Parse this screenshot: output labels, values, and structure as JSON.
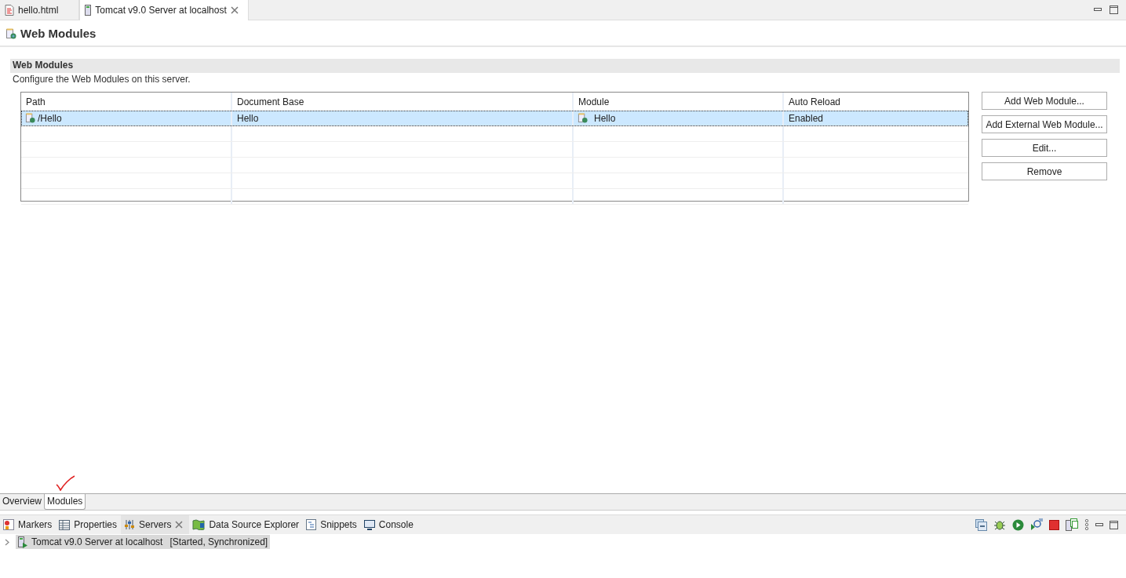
{
  "editor_tabs": [
    {
      "label": "hello.html",
      "kind": "html",
      "selected": false
    },
    {
      "label": "Tomcat v9.0 Server at localhost",
      "kind": "server",
      "selected": true
    }
  ],
  "page_title": "Web Modules",
  "section": {
    "title": "Web Modules",
    "description": "Configure the Web Modules on this server."
  },
  "table": {
    "columns": [
      "Path",
      "Document Base",
      "Module",
      "Auto Reload"
    ],
    "rows": [
      {
        "path": "/Hello",
        "document_base": "Hello",
        "module": "Hello",
        "auto_reload": "Enabled",
        "selected": true
      }
    ]
  },
  "buttons": [
    "Add Web Module...",
    "Add External Web Module...",
    "Edit...",
    "Remove"
  ],
  "page_tabs": [
    {
      "label": "Overview",
      "selected": false
    },
    {
      "label": "Modules",
      "selected": true
    }
  ],
  "view_tabs": [
    {
      "label": "Markers",
      "kind": "markers",
      "selected": false
    },
    {
      "label": "Properties",
      "kind": "properties",
      "selected": false
    },
    {
      "label": "Servers",
      "kind": "servers",
      "selected": true
    },
    {
      "label": "Data Source Explorer",
      "kind": "datasource",
      "selected": false
    },
    {
      "label": "Snippets",
      "kind": "snippets",
      "selected": false
    },
    {
      "label": "Console",
      "kind": "console",
      "selected": false
    }
  ],
  "servers": [
    {
      "name": "Tomcat v9.0 Server at localhost",
      "status": "[Started, Synchronized]",
      "expanded": false,
      "selected": true
    }
  ]
}
